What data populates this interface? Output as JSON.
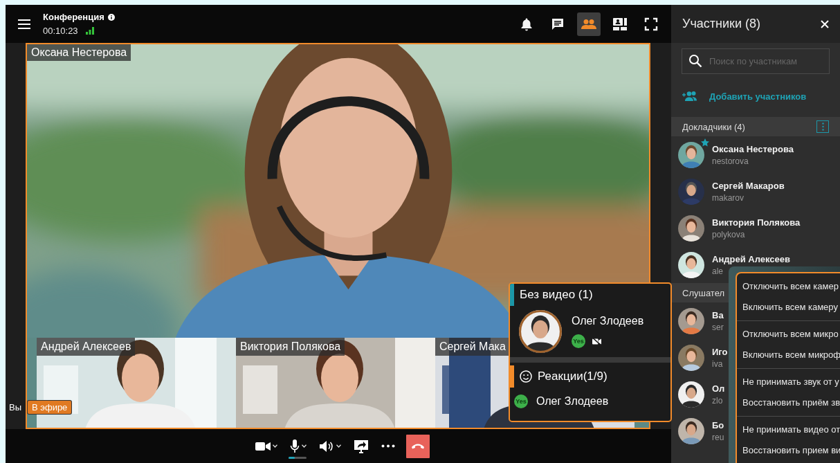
{
  "header": {
    "title": "Конференция",
    "timer": "00:10:23"
  },
  "toolbar": [
    {
      "kind": "bell",
      "selected": false
    },
    {
      "kind": "chat",
      "selected": false
    },
    {
      "kind": "participants",
      "selected": true
    },
    {
      "kind": "layout",
      "selected": false
    },
    {
      "kind": "fullscreen",
      "selected": false
    }
  ],
  "stage": {
    "speaker": "Оксана Нестерова",
    "thumbnails": [
      {
        "name": "Андрей Алексеев"
      },
      {
        "name": "Виктория Полякова"
      },
      {
        "name": "Сергей Мака"
      }
    ],
    "self_label": "Вы",
    "live_badge": "В эфире"
  },
  "controls": [
    {
      "kind": "camera"
    },
    {
      "kind": "microphone",
      "level": 0.35
    },
    {
      "kind": "speaker"
    },
    {
      "kind": "screen_share"
    },
    {
      "kind": "more"
    },
    {
      "kind": "hang_up"
    }
  ],
  "no_video": {
    "title": "Без видео (1)",
    "participants": [
      {
        "name": "Олег Злодеев",
        "reaction": "Yes"
      }
    ]
  },
  "reactions": {
    "title": "Реакции(1/9)",
    "items": [
      {
        "reaction": "Yes",
        "name": "Олег Злодеев"
      }
    ]
  },
  "panel": {
    "title": "Участники (8)",
    "search": {
      "placeholder": "Поиск по участникам"
    },
    "add_label": "Добавить участников",
    "groups": [
      {
        "title": "Докладчики (4)",
        "members": [
          {
            "name": "Оксана Нестерова",
            "login": "nestorova",
            "starred": true
          },
          {
            "name": "Сергей Макаров",
            "login": "makarov",
            "starred": false
          },
          {
            "name": "Виктория Полякова",
            "login": "polykova",
            "starred": false
          },
          {
            "name": "Андрей Алексеев",
            "login": "ale",
            "starred": false
          }
        ]
      },
      {
        "title": "Слушател",
        "members": [
          {
            "name": "Ва",
            "login": "ser",
            "starred": false
          },
          {
            "name": "Иго",
            "login": "iva",
            "starred": false
          },
          {
            "name": "Ол",
            "login": "zlo",
            "starred": false
          },
          {
            "name": "Бо",
            "login": "reu",
            "starred": false
          }
        ]
      }
    ]
  },
  "context_menu": {
    "groups": [
      {
        "items": [
          "Отключить всем камер",
          "Включить всем камеру"
        ]
      },
      {
        "items": [
          "Отключить всем микро",
          "Включить всем микроф"
        ]
      },
      {
        "items": [
          "Не принимать звук от у",
          "Восстановить приём зв"
        ]
      },
      {
        "items": [
          "Не принимать видео от",
          "Восстановить прием ви"
        ]
      }
    ]
  }
}
